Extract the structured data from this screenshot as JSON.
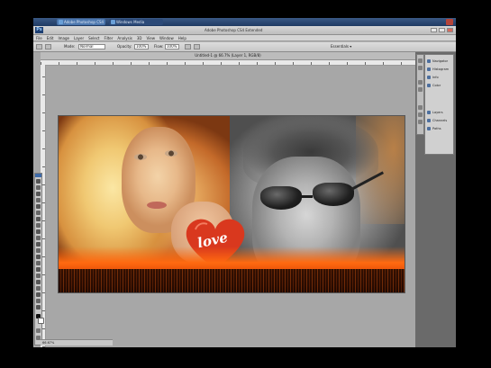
{
  "taskbar": {
    "tabs": [
      {
        "label": "Adobe Photoshop CS4",
        "active": true
      },
      {
        "label": "Windows Media",
        "active": false
      }
    ]
  },
  "app": {
    "logo": "Ps",
    "title": "Adobe Photoshop CS4 Extended"
  },
  "menu": [
    "File",
    "Edit",
    "Image",
    "Layer",
    "Select",
    "Filter",
    "Analysis",
    "3D",
    "View",
    "Window",
    "Help"
  ],
  "options": {
    "mode_label": "Mode:",
    "mode_value": "Normal",
    "opacity_label": "Opacity:",
    "opacity_value": "100%",
    "flow_label": "Flow:",
    "flow_value": "100%",
    "workspace_label": "Essentials ▾"
  },
  "document": {
    "tab_label": "Untitled-1 @ 66.7% (Layer 1, RGB/8)"
  },
  "canvas": {
    "heart_text": "love"
  },
  "panels": {
    "items": [
      {
        "label": "Navigator",
        "icon": "navigator-icon"
      },
      {
        "label": "Histogram",
        "icon": "histogram-icon"
      },
      {
        "label": "Info",
        "icon": "info-icon"
      },
      {
        "label": "Color",
        "icon": "color-icon"
      },
      {
        "label": "Layers",
        "icon": "layers-icon"
      },
      {
        "label": "Channels",
        "icon": "channels-icon"
      },
      {
        "label": "Paths",
        "icon": "paths-icon"
      }
    ]
  },
  "status": {
    "zoom": "66.67%"
  },
  "colors": {
    "fire": "#ff6a10",
    "heart": "#d9381e"
  }
}
